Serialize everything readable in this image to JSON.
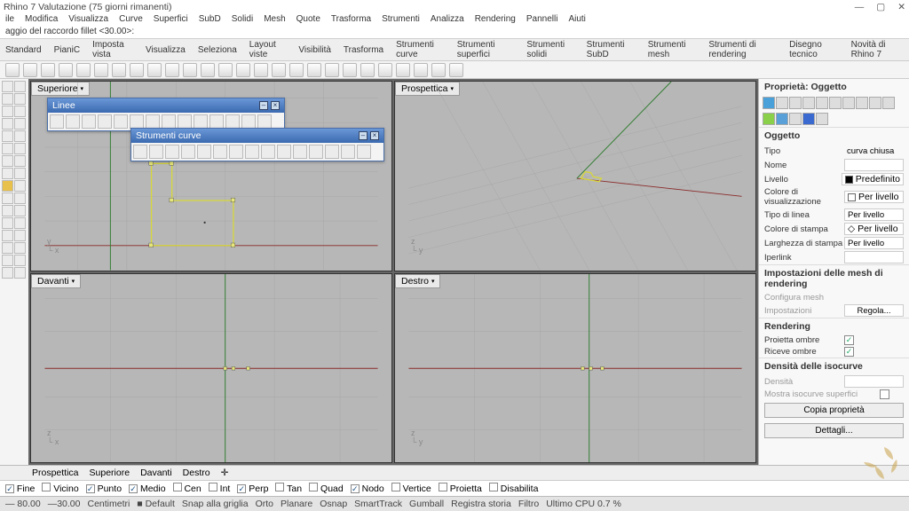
{
  "title_bar": "Rhino 7 Valutazione (75 giorni rimanenti)",
  "window_buttons": [
    "—",
    "▢",
    "✕"
  ],
  "menu": [
    "ile",
    "Modifica",
    "Visualizza",
    "Curve",
    "Superfici",
    "SubD",
    "Solidi",
    "Mesh",
    "Quote",
    "Trasforma",
    "Strumenti",
    "Analizza",
    "Rendering",
    "Pannelli",
    "Aiuti"
  ],
  "command_line": "aggio del raccordo fillet <30.00>:",
  "tool_tabs": [
    "Standard",
    "PianiC",
    "Imposta vista",
    "Visualizza",
    "Seleziona",
    "Layout viste",
    "Visibilità",
    "Trasforma",
    "Strumenti curve",
    "Strumenti superfici",
    "Strumenti solidi",
    "Strumenti SubD",
    "Strumenti mesh",
    "Strumenti di rendering",
    "Disegno tecnico",
    "Novità di Rhino 7"
  ],
  "viewports": {
    "tl": "Superiore",
    "tr": "Prospettica",
    "bl": "Davanti",
    "br": "Destro"
  },
  "float_tb1": {
    "title": "Linee"
  },
  "float_tb2": {
    "title": "Strumenti curve"
  },
  "props": {
    "header": "Proprietà: Oggetto",
    "sect_obj": "Oggetto",
    "rows": {
      "tipo": {
        "k": "Tipo",
        "v": "curva chiusa"
      },
      "nome": {
        "k": "Nome",
        "v": ""
      },
      "livello": {
        "k": "Livello",
        "v": "Predefinito"
      },
      "col_vis": {
        "k": "Colore di visualizzazione",
        "v": "Per livello"
      },
      "tipo_linea": {
        "k": "Tipo di linea",
        "v": "Per livello"
      },
      "col_stampa": {
        "k": "Colore di stampa",
        "v": "Per livello"
      },
      "larg_stampa": {
        "k": "Larghezza di stampa",
        "v": "Per livello"
      },
      "iperlink": {
        "k": "Iperlink",
        "v": ""
      }
    },
    "sect_mesh": "Impostazioni delle mesh di rendering",
    "mesh_rows": {
      "configura": "Configura mesh",
      "impost": "Impostazioni",
      "regola": "Regola..."
    },
    "sect_rend": "Rendering",
    "rend_rows": {
      "proietta": "Proietta ombre",
      "riceve": "Riceve ombre"
    },
    "sect_dens": "Densità delle isocurve",
    "dens_rows": {
      "densita": "Densità",
      "mostra": "Mostra isocurve superfici"
    },
    "btn_copia": "Copia proprietà",
    "btn_dett": "Dettagli..."
  },
  "bottom_tabs": [
    "Prospettica",
    "Superiore",
    "Davanti",
    "Destro",
    "✛"
  ],
  "osnap": [
    {
      "l": "Fine",
      "c": true
    },
    {
      "l": "Vicino",
      "c": false
    },
    {
      "l": "Punto",
      "c": true
    },
    {
      "l": "Medio",
      "c": true
    },
    {
      "l": "Cen",
      "c": false
    },
    {
      "l": "Int",
      "c": false
    },
    {
      "l": "Perp",
      "c": true
    },
    {
      "l": "Tan",
      "c": false
    },
    {
      "l": "Quad",
      "c": false
    },
    {
      "l": "Nodo",
      "c": true
    },
    {
      "l": "Vertice",
      "c": false
    },
    {
      "l": "Proietta",
      "c": false
    },
    {
      "l": "Disabilita",
      "c": false
    }
  ],
  "status": [
    "— 80.00",
    "—30.00",
    "Centimetri",
    "■ Default",
    "Snap alla griglia",
    "Orto",
    "Planare",
    "Osnap",
    "SmartTrack",
    "Gumball",
    "Registra storia",
    "Filtro",
    "Ultimo CPU 0.7 %"
  ]
}
